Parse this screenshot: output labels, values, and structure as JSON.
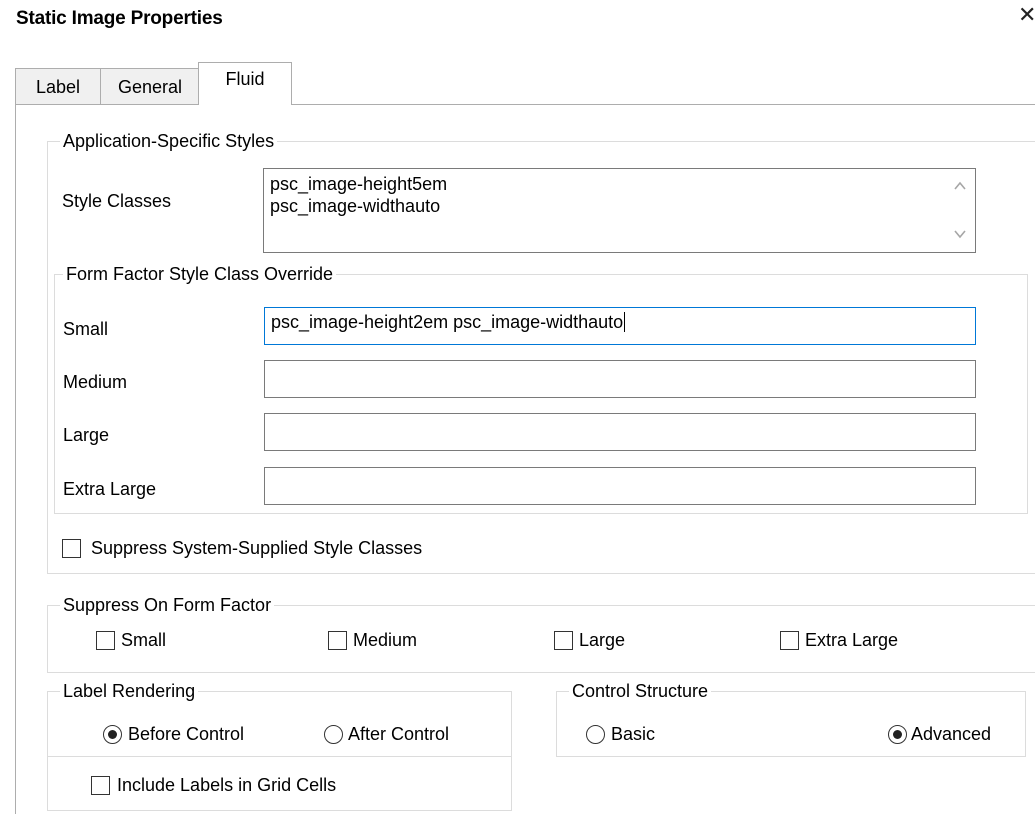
{
  "window": {
    "title": "Static Image Properties",
    "close_glyph": "✕"
  },
  "tabs": [
    {
      "label": "Label",
      "active": false
    },
    {
      "label": "General",
      "active": false
    },
    {
      "label": "Fluid",
      "active": true
    }
  ],
  "app_styles": {
    "legend": "Application-Specific Styles",
    "style_classes_label": "Style Classes",
    "style_classes_lines": [
      "psc_image-height5em",
      "psc_image-widthauto"
    ]
  },
  "form_factor_override": {
    "legend": "Form Factor Style Class Override",
    "small_label": "Small",
    "small_value": "psc_image-height2em psc_image-widthauto",
    "medium_label": "Medium",
    "medium_value": "",
    "large_label": "Large",
    "large_value": "",
    "xlarge_label": "Extra Large",
    "xlarge_value": ""
  },
  "suppress_system": {
    "label": "Suppress System-Supplied Style Classes",
    "checked": false
  },
  "suppress_on_form_factor": {
    "legend": "Suppress On Form Factor",
    "small": "Small",
    "medium": "Medium",
    "large": "Large",
    "xlarge": "Extra Large"
  },
  "label_rendering": {
    "legend": "Label Rendering",
    "before": "Before Control",
    "after": "After Control",
    "selected": "Before Control",
    "include_labels": "Include Labels in Grid Cells"
  },
  "control_structure": {
    "legend": "Control Structure",
    "basic": "Basic",
    "advanced": "Advanced",
    "selected": "Advanced"
  }
}
